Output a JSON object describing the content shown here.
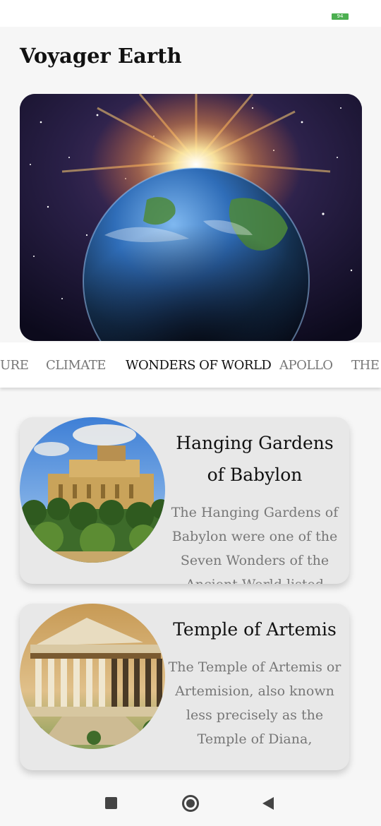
{
  "status_bar": {
    "battery": "94"
  },
  "app": {
    "title": "Voyager Earth"
  },
  "hero": {
    "image": "earth-from-space-image"
  },
  "tabs": [
    {
      "label": "URE"
    },
    {
      "label": "CLIMATE"
    },
    {
      "label": "WONDERS OF WORLD"
    },
    {
      "label": "APOLLO"
    },
    {
      "label": "THE V"
    }
  ],
  "active_tab": "WONDERS OF WORLD",
  "cards": [
    {
      "title": "Hanging Gardens of Babylon",
      "description": "The Hanging Gardens of Babylon were one of the Seven Wonders of the Ancient World listed",
      "image": "hanging-gardens-image"
    },
    {
      "title": "Temple of Artemis",
      "description": "The Temple of Artemis or Artemision, also known less precisely as the Temple of Diana,",
      "image": "temple-of-artemis-image"
    }
  ],
  "nav": {
    "recents": "square-icon",
    "home": "circle-icon",
    "back": "triangle-back-icon"
  }
}
